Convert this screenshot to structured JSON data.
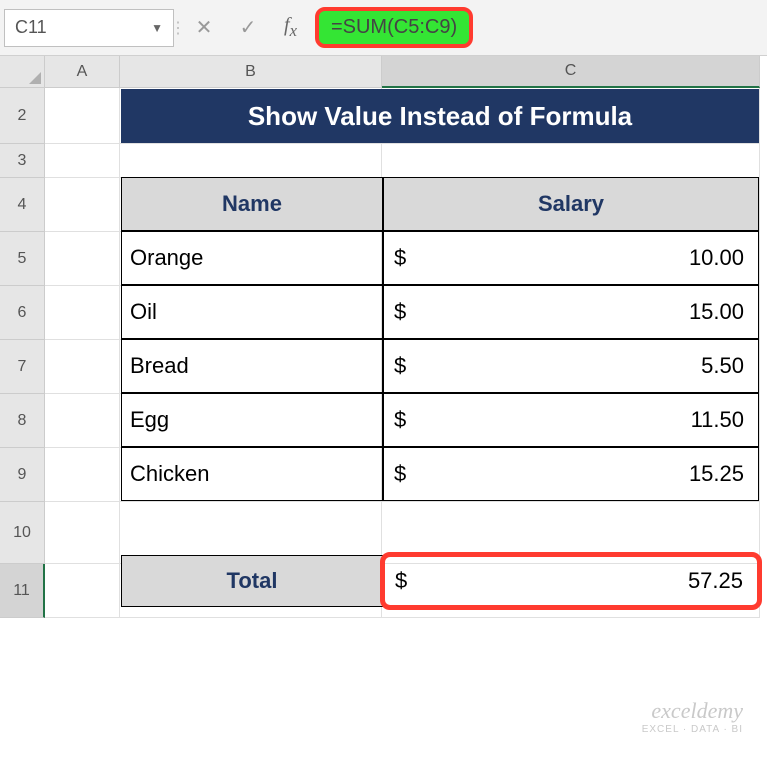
{
  "nameBox": "C11",
  "formula": "=SUM(C5:C9)",
  "columns": [
    "A",
    "B",
    "C"
  ],
  "rows": [
    "2",
    "3",
    "4",
    "5",
    "6",
    "7",
    "8",
    "9",
    "10",
    "11"
  ],
  "title": "Show Value Instead of Formula",
  "headers": {
    "name": "Name",
    "salary": "Salary"
  },
  "items": [
    {
      "name": "Orange",
      "salary": "10.00"
    },
    {
      "name": "Oil",
      "salary": "15.00"
    },
    {
      "name": "Bread",
      "salary": "5.50"
    },
    {
      "name": "Egg",
      "salary": "11.50"
    },
    {
      "name": "Chicken",
      "salary": "15.25"
    }
  ],
  "currency": "$",
  "total": {
    "label": "Total",
    "value": "57.25"
  },
  "watermark": {
    "brand": "exceldemy",
    "tag": "EXCEL · DATA · BI"
  },
  "selectedCell": "C11"
}
